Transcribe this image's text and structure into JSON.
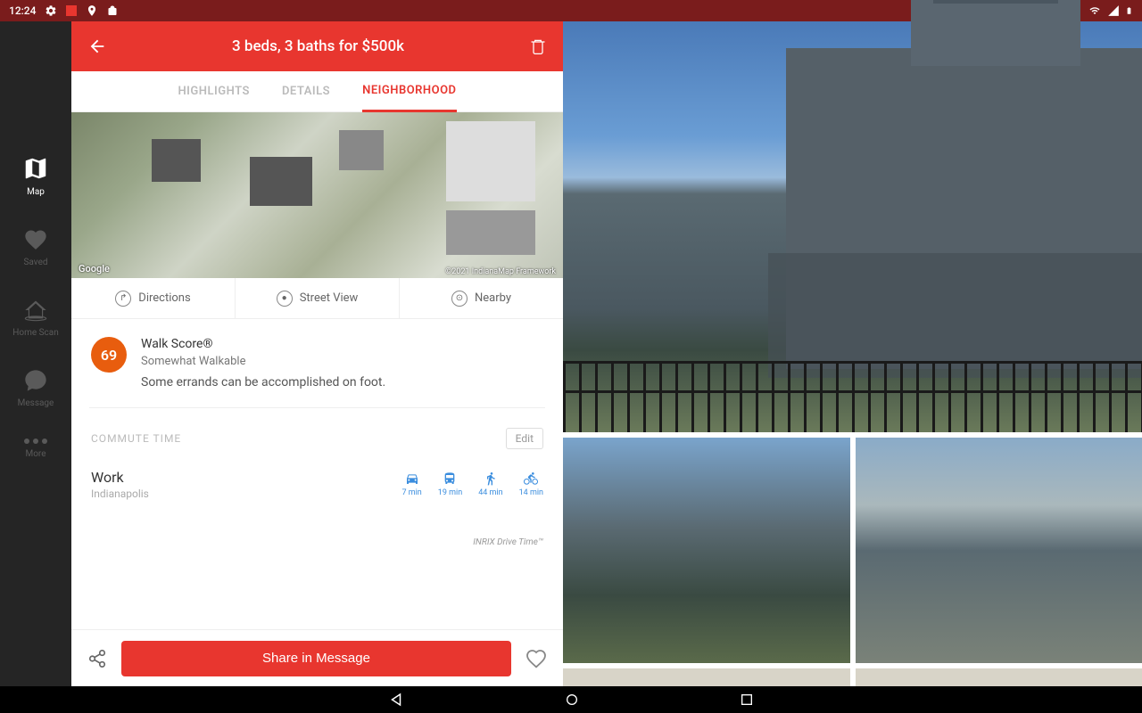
{
  "statusbar": {
    "time": "12:24"
  },
  "sidebar": {
    "items": [
      {
        "label": "Map"
      },
      {
        "label": "Saved"
      },
      {
        "label": "Home Scan"
      },
      {
        "label": "Message"
      },
      {
        "label": "More"
      }
    ]
  },
  "header": {
    "title": "3 beds, 3 baths for $500k"
  },
  "tabs": {
    "highlights": "HIGHLIGHTS",
    "details": "DETAILS",
    "neighborhood": "NEIGHBORHOOD"
  },
  "map": {
    "attribution": "Google",
    "copyright": "©2021 IndianaMap Framework"
  },
  "map_actions": {
    "directions": "Directions",
    "street_view": "Street View",
    "nearby": "Nearby"
  },
  "walk_score": {
    "value": "69",
    "title": "Walk Score®",
    "subtitle": "Somewhat Walkable",
    "desc": "Some errands can be accomplished on foot."
  },
  "commute": {
    "section_label": "COMMUTE TIME",
    "edit": "Edit",
    "dest_name": "Work",
    "dest_city": "Indianapolis",
    "times": [
      {
        "label": "7 min"
      },
      {
        "label": "19 min"
      },
      {
        "label": "44 min"
      },
      {
        "label": "14 min"
      }
    ],
    "inrix": "INRIX Drive Time™"
  },
  "footer": {
    "share": "Share in Message"
  }
}
